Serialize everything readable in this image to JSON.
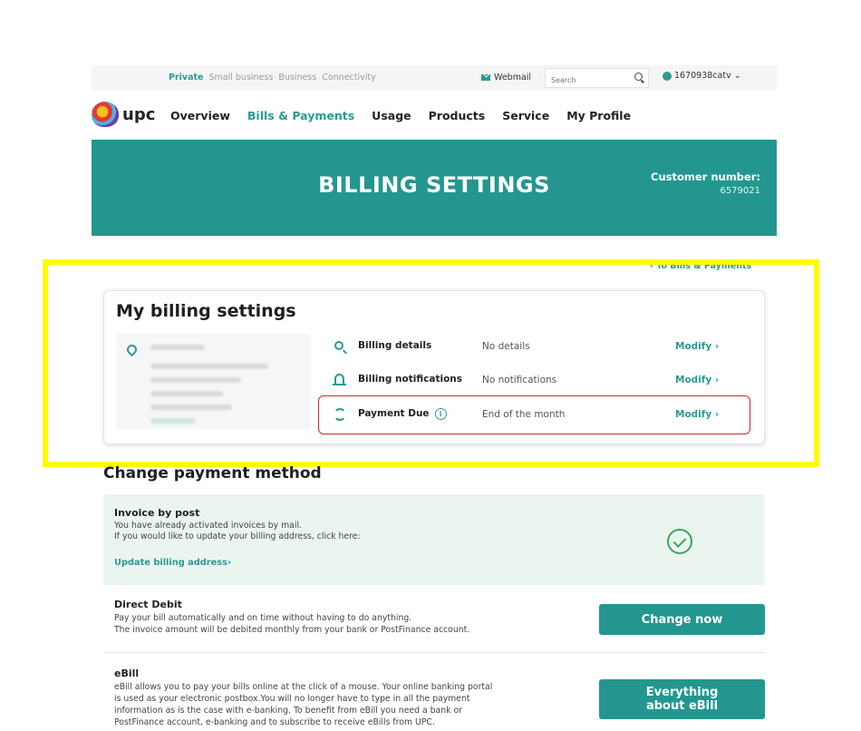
{
  "topbar": {
    "nav": [
      "Private",
      "Small business",
      "Business",
      "Connectivity"
    ],
    "webmail": "Webmail",
    "search_placeholder": "Search",
    "account": "1670938catv"
  },
  "mainnav": {
    "logo": "upc",
    "items": [
      "Overview",
      "Bills & Payments",
      "Usage",
      "Products",
      "Service",
      "My Profile"
    ]
  },
  "hero": {
    "title": "BILLING SETTINGS",
    "customer_label": "Customer number:",
    "customer_number": "6579021"
  },
  "back_link": "‹ To Bills & Payments",
  "billing_settings": {
    "title": "My billing settings",
    "rows": [
      {
        "label": "Billing details",
        "value": "No details",
        "action": "Modify ›",
        "icon": "search-icon"
      },
      {
        "label": "Billing notifications",
        "value": "No notifications",
        "action": "Modify ›",
        "icon": "bell-icon"
      },
      {
        "label": "Payment Due",
        "value": "End of the month",
        "action": "Modify ›",
        "icon": "cycle-icon"
      }
    ],
    "info_symbol": "i"
  },
  "payment": {
    "title": "Change payment method",
    "invoice": {
      "heading": "Invoice by post",
      "line1": "You have already activated invoices by mail.",
      "line2": "If you would like to update your billing address, click here:",
      "link": "Update billing address›"
    },
    "direct": {
      "heading": "Direct Debit",
      "line1": "Pay your bill automatically and on time without having to do anything.",
      "line2": "The invoice amount will be debited monthly from your bank or PostFinance account.",
      "button": "Change now"
    },
    "ebill": {
      "heading": "eBill",
      "line1": "eBill allows you to pay your bills online at the click of a mouse. Your online banking portal",
      "line2": "is used as your electronic postbox.You will no longer have to type in all the payment",
      "line3": "information as is the case with e-banking. To benefit from eBill you need a bank or",
      "line4": "PostFinance account, e-banking and to subscribe to receive eBills from UPC.",
      "button": "Everything about eBill"
    }
  },
  "colors": {
    "teal": "#23978f",
    "highlight": "#fdfb00",
    "red": "#d8262c"
  }
}
